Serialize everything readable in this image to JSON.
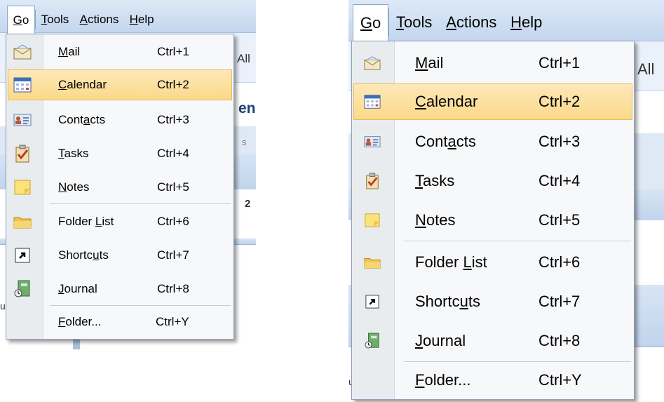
{
  "menubar": {
    "items": [
      {
        "pre": "",
        "key": "G",
        "post": "o"
      },
      {
        "pre": "",
        "key": "T",
        "post": "ools"
      },
      {
        "pre": "",
        "key": "A",
        "post": "ctions"
      },
      {
        "pre": "",
        "key": "H",
        "post": "elp"
      }
    ]
  },
  "background": {
    "fragment_all": "All",
    "fragment_en": "en",
    "fragment_s": "s",
    "fragment_2": "2",
    "fragment_u": "u"
  },
  "go_menu": {
    "items": [
      {
        "pre": "",
        "key": "M",
        "post": "ail",
        "shortcut": "Ctrl+1",
        "icon": "mail-icon"
      },
      {
        "pre": "",
        "key": "C",
        "post": "alendar",
        "shortcut": "Ctrl+2",
        "icon": "calendar-icon"
      },
      {
        "pre": "Cont",
        "key": "a",
        "post": "cts",
        "shortcut": "Ctrl+3",
        "icon": "contacts-icon"
      },
      {
        "pre": "",
        "key": "T",
        "post": "asks",
        "shortcut": "Ctrl+4",
        "icon": "tasks-icon"
      },
      {
        "pre": "",
        "key": "N",
        "post": "otes",
        "shortcut": "Ctrl+5",
        "icon": "notes-icon"
      },
      {
        "pre": "Folder ",
        "key": "L",
        "post": "ist",
        "shortcut": "Ctrl+6",
        "icon": "folder-icon"
      },
      {
        "pre": "Shortc",
        "key": "u",
        "post": "ts",
        "shortcut": "Ctrl+7",
        "icon": "shortcut-icon"
      },
      {
        "pre": "",
        "key": "J",
        "post": "ournal",
        "shortcut": "Ctrl+8",
        "icon": "journal-icon"
      },
      {
        "pre": "",
        "key": "F",
        "post": "older...",
        "shortcut": "Ctrl+Y",
        "icon": ""
      }
    ],
    "highlighted_item": "Calendar"
  },
  "colors": {
    "highlight": "#fbd98a",
    "highlight_border": "#e8b95e",
    "menu_background": "#f7f8fa",
    "gutter": "#e9ecef",
    "menubar": "#c3d6ee"
  }
}
